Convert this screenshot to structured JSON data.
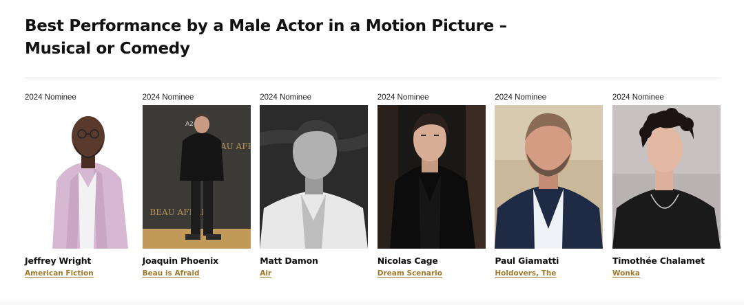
{
  "category": {
    "title": "Best Performance by a Male Actor in a Motion Picture – Musical or Comedy"
  },
  "nominees": [
    {
      "year_label": "2024 Nominee",
      "name": "Jeffrey Wright",
      "film": "American Fiction"
    },
    {
      "year_label": "2024 Nominee",
      "name": "Joaquin Phoenix",
      "film": "Beau is Afraid"
    },
    {
      "year_label": "2024 Nominee",
      "name": "Matt Damon",
      "film": "Air"
    },
    {
      "year_label": "2024 Nominee",
      "name": "Nicolas Cage",
      "film": "Dream Scenario"
    },
    {
      "year_label": "2024 Nominee",
      "name": "Paul Giamatti",
      "film": "Holdovers, The"
    },
    {
      "year_label": "2024 Nominee",
      "name": "Timothée Chalamet",
      "film": "Wonka"
    }
  ],
  "backdrop_text": {
    "poster_logo": "BEAU AFRAID",
    "poster_brand": "A24"
  },
  "colors": {
    "film_link": "#a07a2c",
    "divider": "#e2e2e2",
    "text": "#111111"
  }
}
